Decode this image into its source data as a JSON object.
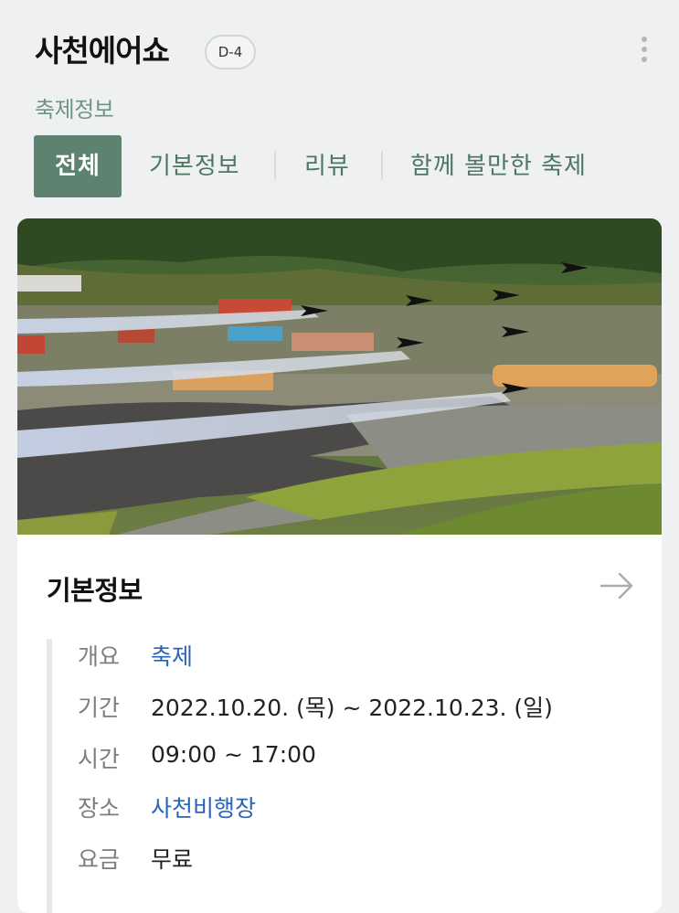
{
  "header": {
    "title": "사천에어쇼",
    "dday_badge": "D-4",
    "subtitle": "축제정보",
    "more_icon": "more-vertical-icon"
  },
  "tabs": [
    {
      "label": "전체",
      "active": true
    },
    {
      "label": "기본정보",
      "active": false
    },
    {
      "label": "리뷰",
      "active": false
    },
    {
      "label": "함께 볼만한 축제",
      "active": false
    }
  ],
  "colors": {
    "accent": "#5c8270",
    "subtitle": "#6f9580",
    "link": "#2a64b8",
    "background": "#eef0f2"
  },
  "basic_info": {
    "title": "기본정보",
    "arrow_icon": "arrow-right-icon",
    "rows": [
      {
        "label": "개요",
        "value": "축제",
        "link": true
      },
      {
        "label": "기간",
        "value": "2022.10.20. (목) ~ 2022.10.23. (일)",
        "link": false
      },
      {
        "label": "시간",
        "value": "09:00 ~ 17:00",
        "link": false
      },
      {
        "label": "장소",
        "value": "사천비행장",
        "link": true
      },
      {
        "label": "요금",
        "value": "무료",
        "link": false
      }
    ]
  }
}
